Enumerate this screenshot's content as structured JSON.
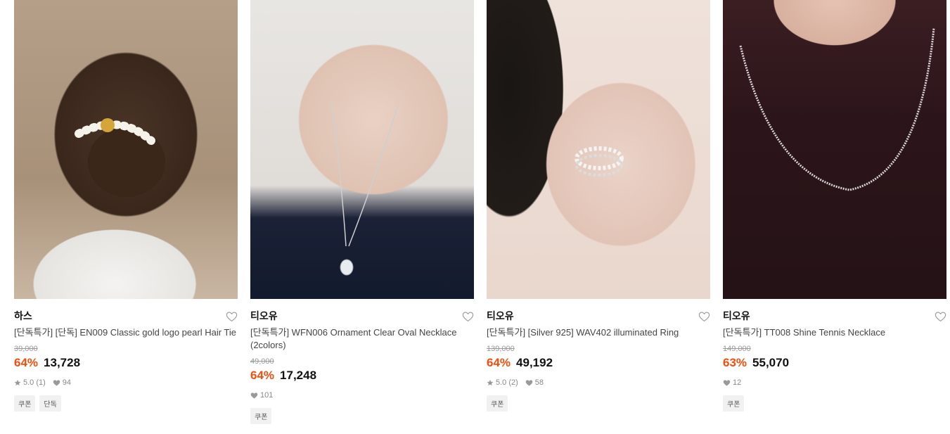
{
  "products": [
    {
      "brand": "하스",
      "name": "[단독특가] [단독] EN009 Classic gold logo pearl Hair Tie",
      "original_price": "39,000",
      "discount": "64%",
      "price": "13,728",
      "rating": "5.0 (1)",
      "likes": "94",
      "tags": [
        "쿠폰",
        "단독"
      ]
    },
    {
      "brand": "티오유",
      "name": "[단독특가] WFN006 Ornament Clear Oval Necklace (2colors)",
      "original_price": "49,000",
      "discount": "64%",
      "price": "17,248",
      "rating": "",
      "likes": "101",
      "tags": [
        "쿠폰"
      ]
    },
    {
      "brand": "티오유",
      "name": "[단독특가] [Silver 925] WAV402 illuminated Ring",
      "original_price": "139,000",
      "discount": "64%",
      "price": "49,192",
      "rating": "5.0 (2)",
      "likes": "58",
      "tags": [
        "쿠폰"
      ]
    },
    {
      "brand": "티오유",
      "name": "[단독특가] TT008 Shine Tennis Necklace",
      "original_price": "149,000",
      "discount": "63%",
      "price": "55,070",
      "rating": "",
      "likes": "12",
      "tags": [
        "쿠폰"
      ]
    }
  ],
  "colors": {
    "discount": "#f24d0d",
    "text": "#111111",
    "muted": "#888888"
  }
}
